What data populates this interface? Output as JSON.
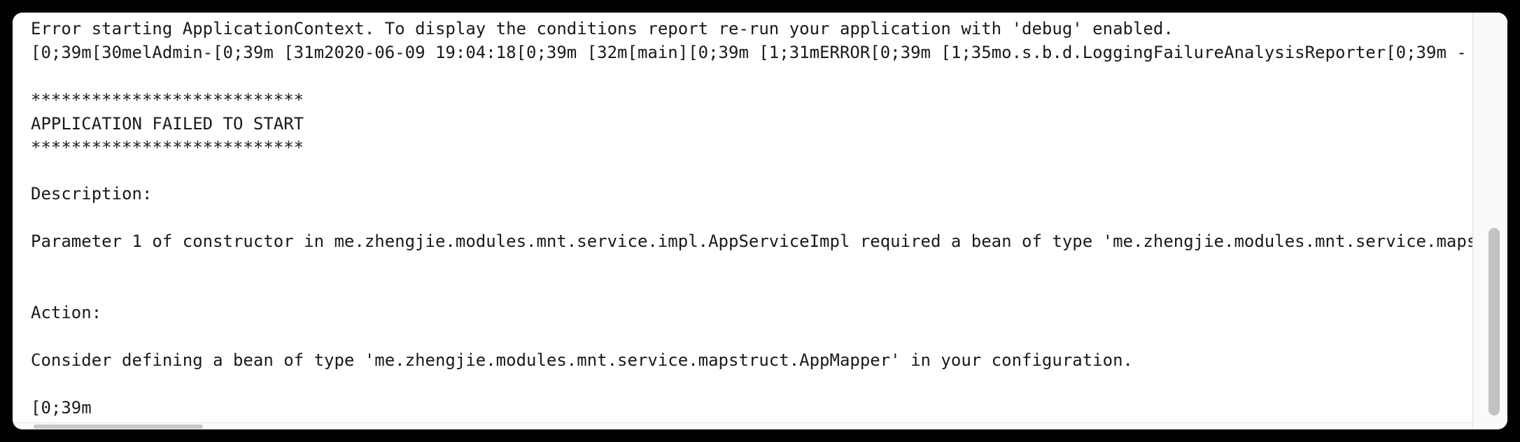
{
  "console": {
    "lines": [
      "Error starting ApplicationContext. To display the conditions report re-run your application with 'debug' enabled.",
      "[0;39m[30melAdmin-[0;39m [31m2020-06-09 19:04:18[0;39m [32m[main][0;39m [1;31mERROR[0;39m [1;35mo.s.b.d.LoggingFailureAnalysisReporter[0;39m -",
      "***************************",
      "APPLICATION FAILED TO START",
      "***************************",
      "Description:",
      "Parameter 1 of constructor in me.zhengjie.modules.mnt.service.impl.AppServiceImpl required a bean of type 'me.zhengjie.modules.mnt.service.maps",
      "Action:",
      "Consider defining a bean of type 'me.zhengjie.modules.mnt.service.mapstruct.AppMapper' in your configuration.",
      "[0;39m"
    ]
  }
}
